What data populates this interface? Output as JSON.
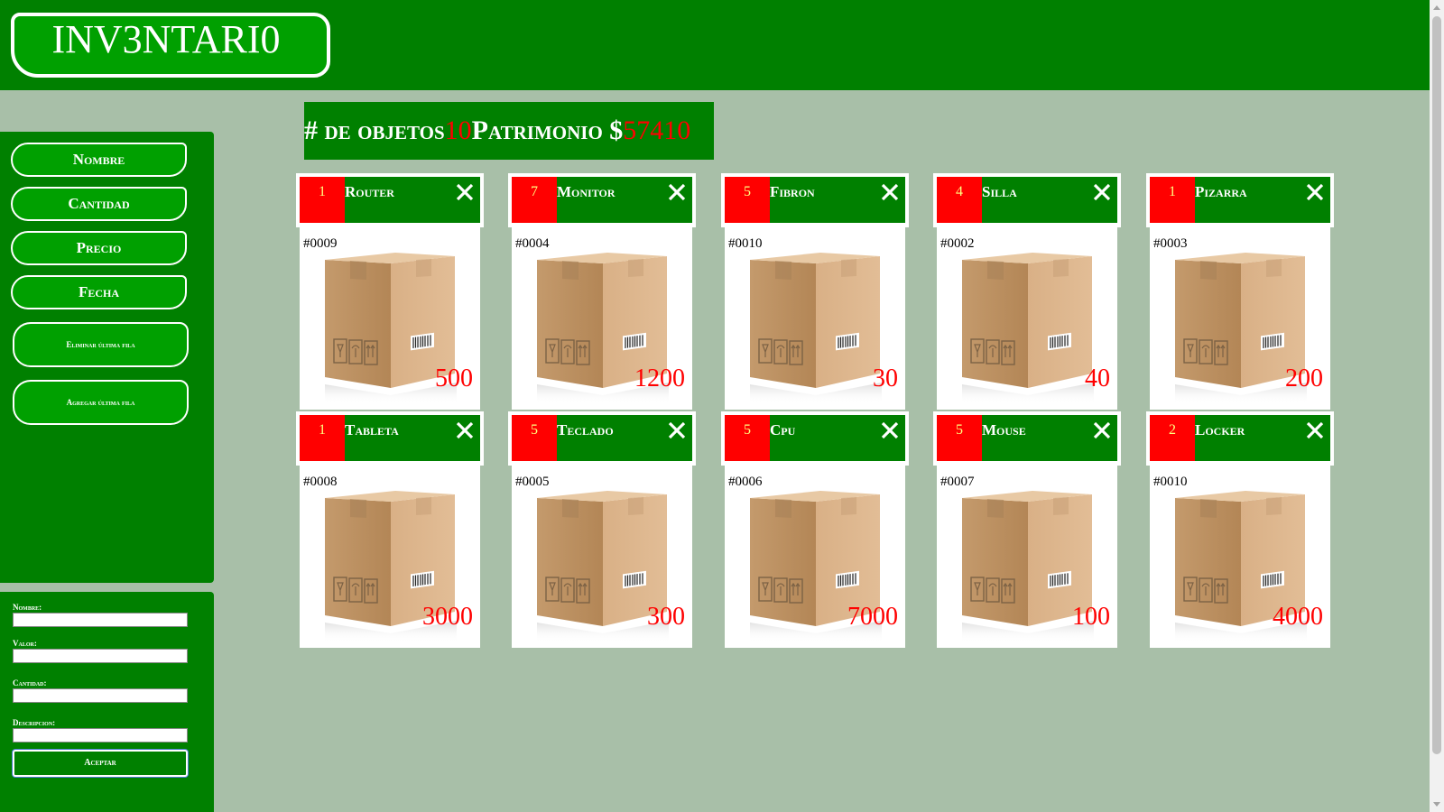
{
  "app": {
    "logo": "INV3NTARI0"
  },
  "sidebar": {
    "sort_buttons": [
      "Nombre",
      "Cantidad",
      "Precio",
      "Fecha"
    ],
    "row_buttons": [
      "Eliminar última fila",
      "Agregar última fila"
    ]
  },
  "form": {
    "fields": [
      {
        "label": "Nombre:",
        "value": ""
      },
      {
        "label": "Valor:",
        "value": ""
      },
      {
        "label": "Cantidad:",
        "value": ""
      },
      {
        "label": "Descripcion:",
        "value": ""
      }
    ],
    "submit_label": "Aceptar"
  },
  "stats": {
    "count_label": "# de objetos",
    "count_value": "10",
    "patrimony_label": "Patrimonio $",
    "patrimony_value": "57410"
  },
  "items": [
    {
      "qty": "1",
      "name": "Router",
      "code": "#0009",
      "price": "500"
    },
    {
      "qty": "7",
      "name": "Monitor",
      "code": "#0004",
      "price": "1200"
    },
    {
      "qty": "5",
      "name": "Fibron",
      "code": "#0010",
      "price": "30"
    },
    {
      "qty": "4",
      "name": "Silla",
      "code": "#0002",
      "price": "40"
    },
    {
      "qty": "1",
      "name": "Pizarra",
      "code": "#0003",
      "price": "200"
    },
    {
      "qty": "1",
      "name": "Tableta",
      "code": "#0008",
      "price": "3000"
    },
    {
      "qty": "5",
      "name": "Teclado",
      "code": "#0005",
      "price": "300"
    },
    {
      "qty": "5",
      "name": "Cpu",
      "code": "#0006",
      "price": "7000"
    },
    {
      "qty": "5",
      "name": "Mouse",
      "code": "#0007",
      "price": "100"
    },
    {
      "qty": "2",
      "name": "Locker",
      "code": "#0010",
      "price": "4000"
    }
  ],
  "icons": {
    "close": "close-icon",
    "item_image": "cardboard-box-icon"
  },
  "colors": {
    "primary": "#008000",
    "accent": "#ff0000",
    "background": "#a8bfa8"
  }
}
